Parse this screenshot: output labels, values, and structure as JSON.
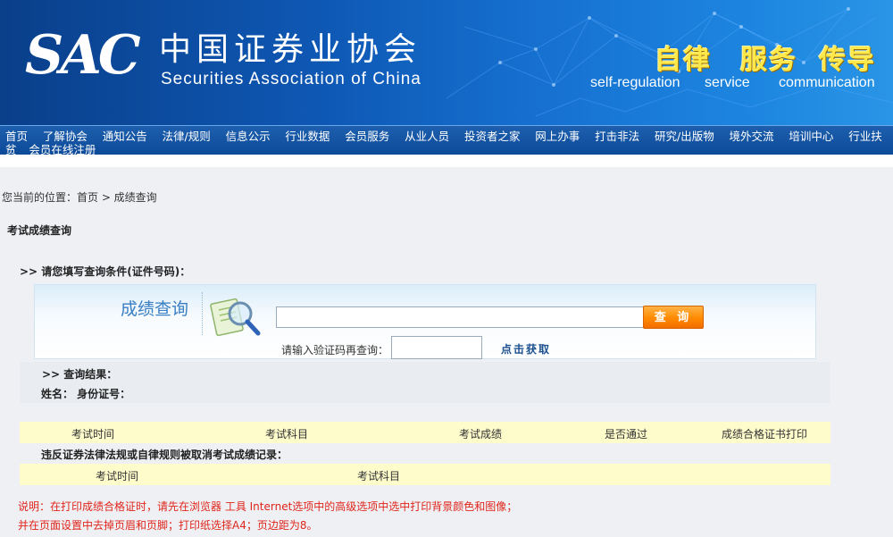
{
  "header": {
    "logo": "SAC",
    "org_cn": "中国证券业协会",
    "org_en": "Securities Association of China",
    "slogans": [
      {
        "cn": "自律",
        "en": "self-regulation"
      },
      {
        "cn": "服务",
        "en": "service"
      },
      {
        "cn": "传导",
        "en": "communication"
      }
    ]
  },
  "nav": {
    "row1": [
      "首页",
      "了解协会",
      "通知公告",
      "法律/规则",
      "信息公示",
      "行业数据",
      "会员服务",
      "从业人员",
      "投资者之家",
      "网上办事",
      "打击非法",
      "研究/出版物",
      "境外交流",
      "培训中心",
      "行业扶"
    ],
    "row2": [
      "贫",
      "会员在线注册"
    ]
  },
  "breadcrumb": "您当前的位置：首页 > 成绩查询",
  "section_title": "考试成绩查询",
  "query": {
    "prompt": ">> 请您填写查询条件(证件号码)：",
    "box_title": "成绩查询",
    "id_value": "",
    "search_label": "查 询",
    "captcha_label": "请输入验证码再查询：",
    "captcha_value": "",
    "captcha_link": "点击获取"
  },
  "results": {
    "title": ">> 查询结果：",
    "fields": "姓名：  身份证号："
  },
  "score_table": {
    "columns": [
      "考试时间",
      "考试科目",
      "考试成绩",
      "是否通过",
      "成绩合格证书打印"
    ]
  },
  "violation": {
    "title": "违反证券法律法规或自律规则被取消考试成绩记录：",
    "columns": [
      "考试时间",
      "考试科目"
    ]
  },
  "notes": [
    "说明：在打印成绩合格证时，请先在浏览器 工具 Internet选项中的高级选项中选中打印背景颜色和图像；",
    "并在页面设置中去掉页眉和页脚；打印纸选择A4；页边距为8。"
  ],
  "colors": {
    "banner": "#0e57b3",
    "nav": "#0c4a98",
    "accent_orange": "#ff8a00",
    "note_red": "#e0251b",
    "table_header": "#fffccc"
  }
}
